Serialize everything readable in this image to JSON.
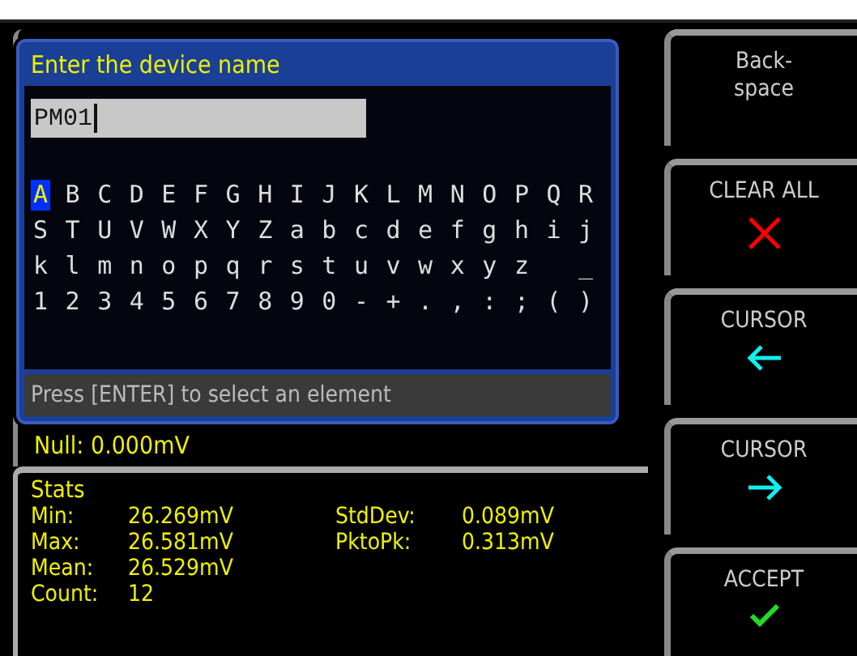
{
  "dialog": {
    "title": "Enter the device name",
    "value": "PM01",
    "hint": "Press [ENTER] to select an element",
    "keys": [
      [
        {
          "kind": "key",
          "char": "A",
          "selected": true
        },
        {
          "kind": "key",
          "char": "B",
          "selected": false
        },
        {
          "kind": "key",
          "char": "C",
          "selected": false
        },
        {
          "kind": "key",
          "char": "D",
          "selected": false
        },
        {
          "kind": "key",
          "char": "E",
          "selected": false
        },
        {
          "kind": "key",
          "char": "F",
          "selected": false
        },
        {
          "kind": "key",
          "char": "G",
          "selected": false
        },
        {
          "kind": "key",
          "char": "H",
          "selected": false
        },
        {
          "kind": "key",
          "char": "I",
          "selected": false
        },
        {
          "kind": "key",
          "char": "J",
          "selected": false
        },
        {
          "kind": "key",
          "char": "K",
          "selected": false
        },
        {
          "kind": "key",
          "char": "L",
          "selected": false
        },
        {
          "kind": "key",
          "char": "M",
          "selected": false
        },
        {
          "kind": "key",
          "char": "N",
          "selected": false
        },
        {
          "kind": "key",
          "char": "O",
          "selected": false
        },
        {
          "kind": "key",
          "char": "P",
          "selected": false
        },
        {
          "kind": "key",
          "char": "Q",
          "selected": false
        },
        {
          "kind": "key",
          "char": "R",
          "selected": false
        }
      ],
      [
        {
          "kind": "key",
          "char": "S",
          "selected": false
        },
        {
          "kind": "key",
          "char": "T",
          "selected": false
        },
        {
          "kind": "key",
          "char": "U",
          "selected": false
        },
        {
          "kind": "key",
          "char": "V",
          "selected": false
        },
        {
          "kind": "key",
          "char": "W",
          "selected": false
        },
        {
          "kind": "key",
          "char": "X",
          "selected": false
        },
        {
          "kind": "key",
          "char": "Y",
          "selected": false
        },
        {
          "kind": "key",
          "char": "Z",
          "selected": false
        },
        {
          "kind": "key",
          "char": "a",
          "selected": false
        },
        {
          "kind": "key",
          "char": "b",
          "selected": false
        },
        {
          "kind": "key",
          "char": "c",
          "selected": false
        },
        {
          "kind": "key",
          "char": "d",
          "selected": false
        },
        {
          "kind": "key",
          "char": "e",
          "selected": false
        },
        {
          "kind": "key",
          "char": "f",
          "selected": false
        },
        {
          "kind": "key",
          "char": "g",
          "selected": false
        },
        {
          "kind": "key",
          "char": "h",
          "selected": false
        },
        {
          "kind": "key",
          "char": "i",
          "selected": false
        },
        {
          "kind": "key",
          "char": "j",
          "selected": false
        }
      ],
      [
        {
          "kind": "key",
          "char": "k",
          "selected": false
        },
        {
          "kind": "key",
          "char": "l",
          "selected": false
        },
        {
          "kind": "key",
          "char": "m",
          "selected": false
        },
        {
          "kind": "key",
          "char": "n",
          "selected": false
        },
        {
          "kind": "key",
          "char": "o",
          "selected": false
        },
        {
          "kind": "key",
          "char": "p",
          "selected": false
        },
        {
          "kind": "key",
          "char": "q",
          "selected": false
        },
        {
          "kind": "key",
          "char": "r",
          "selected": false
        },
        {
          "kind": "key",
          "char": "s",
          "selected": false
        },
        {
          "kind": "key",
          "char": "t",
          "selected": false
        },
        {
          "kind": "key",
          "char": "u",
          "selected": false
        },
        {
          "kind": "key",
          "char": "v",
          "selected": false
        },
        {
          "kind": "key",
          "char": "w",
          "selected": false
        },
        {
          "kind": "key",
          "char": "x",
          "selected": false
        },
        {
          "kind": "key",
          "char": "y",
          "selected": false
        },
        {
          "kind": "key",
          "char": "z",
          "selected": false
        },
        {
          "kind": "blank"
        },
        {
          "kind": "key",
          "char": "_",
          "selected": false
        }
      ],
      [
        {
          "kind": "key",
          "char": "1",
          "selected": false
        },
        {
          "kind": "key",
          "char": "2",
          "selected": false
        },
        {
          "kind": "key",
          "char": "3",
          "selected": false
        },
        {
          "kind": "key",
          "char": "4",
          "selected": false
        },
        {
          "kind": "key",
          "char": "5",
          "selected": false
        },
        {
          "kind": "key",
          "char": "6",
          "selected": false
        },
        {
          "kind": "key",
          "char": "7",
          "selected": false
        },
        {
          "kind": "key",
          "char": "8",
          "selected": false
        },
        {
          "kind": "key",
          "char": "9",
          "selected": false
        },
        {
          "kind": "key",
          "char": "0",
          "selected": false
        },
        {
          "kind": "key",
          "char": "-",
          "selected": false
        },
        {
          "kind": "key",
          "char": "+",
          "selected": false
        },
        {
          "kind": "key",
          "char": ".",
          "selected": false
        },
        {
          "kind": "key",
          "char": ",",
          "selected": false
        },
        {
          "kind": "key",
          "char": ":",
          "selected": false
        },
        {
          "kind": "key",
          "char": ";",
          "selected": false
        },
        {
          "kind": "key",
          "char": "(",
          "selected": false
        },
        {
          "kind": "key",
          "char": ")",
          "selected": false
        }
      ]
    ]
  },
  "null_reading": "Null: 0.000mV",
  "stats": {
    "title": "Stats",
    "rows": [
      {
        "label": "Min:",
        "value": "26.269mV",
        "label_2": "StdDev:",
        "value_2": "0.089mV"
      },
      {
        "label": "Max:",
        "value": "26.581mV",
        "label_2": "PktoPk:",
        "value_2": "0.313mV"
      },
      {
        "label": "Mean:",
        "value": "26.529mV"
      },
      {
        "label": "Count:",
        "value": "12"
      }
    ]
  },
  "softkeys": [
    {
      "label": "Back-\nspace",
      "kind": "plain"
    },
    {
      "label": "CLEAR ALL",
      "kind": "clear"
    },
    {
      "label": "CURSOR",
      "kind": "back"
    },
    {
      "label": "CURSOR",
      "kind": "forward"
    },
    {
      "label": "ACCEPT",
      "kind": "accept"
    }
  ]
}
